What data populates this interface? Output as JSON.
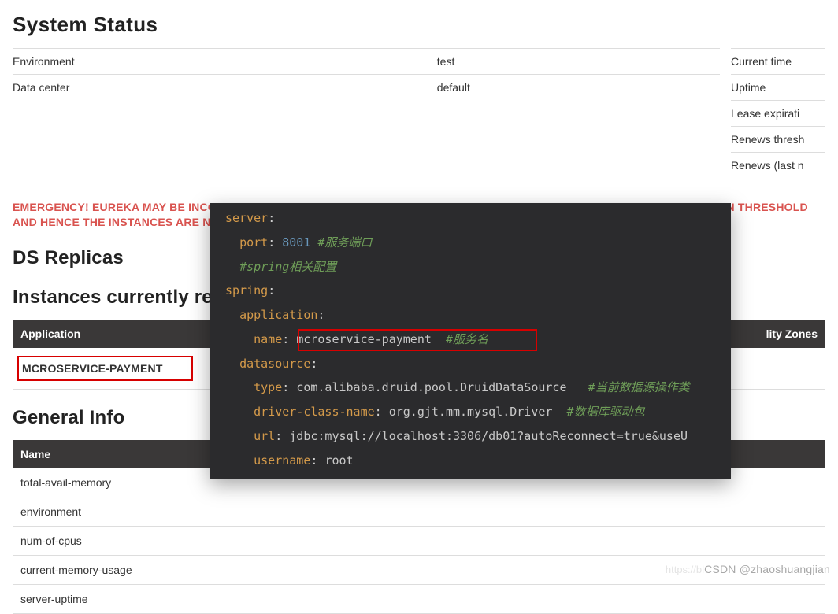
{
  "header": {
    "title": "System Status"
  },
  "status_left": [
    {
      "label": "Environment",
      "value": "test"
    },
    {
      "label": "Data center",
      "value": "default"
    }
  ],
  "status_right": [
    {
      "label": "Current time"
    },
    {
      "label": "Uptime"
    },
    {
      "label": "Lease expirati"
    },
    {
      "label": "Renews thresh"
    },
    {
      "label": "Renews (last n"
    }
  ],
  "emergency": "EMERGENCY! EUREKA MAY BE INCORRECTLY CLAIMING INSTANCES ARE UP WHEN THEY'RE NOT. RENEWALS ARE LESSER THAN THRESHOLD AND HENCE THE INSTANCES ARE NOT BEING EXPIRED JUST TO BE SAFE.",
  "ds_replicas_title": "DS Replicas",
  "instances_title": "Instances currently re",
  "instances_table": {
    "headers": {
      "app": "Application",
      "zones": "lity Zones"
    },
    "app_value": "MCROSERVICE-PAYMENT"
  },
  "general_info": {
    "title": "General Info",
    "header": "Name",
    "rows": [
      "total-avail-memory",
      "environment",
      "num-of-cpus",
      "current-memory-usage",
      "server-uptime"
    ]
  },
  "yaml": {
    "server_key": "server",
    "port_key": "port",
    "port_val": "8001",
    "port_cmt": "#服务端口",
    "spring_cmt": "#spring相关配置",
    "spring_key": "spring",
    "application_key": "application",
    "name_key": "name",
    "name_val": "mcroservice-payment",
    "name_cmt": "#服务名",
    "datasource_key": "datasource",
    "type_key": "type",
    "type_val": "com.alibaba.druid.pool.DruidDataSource",
    "type_cmt": "#当前数据源操作类",
    "driver_key": "driver-class-name",
    "driver_val": "org.gjt.mm.mysql.Driver",
    "driver_cmt": "#数据库驱动包",
    "url_key": "url",
    "url_val": "jdbc:mysql://localhost:3306/db01?autoReconnect=true&useU",
    "username_key": "username",
    "username_val": "root"
  },
  "watermark": "CSDN @zhaoshuangjian",
  "watermark_faint": "https://bl"
}
